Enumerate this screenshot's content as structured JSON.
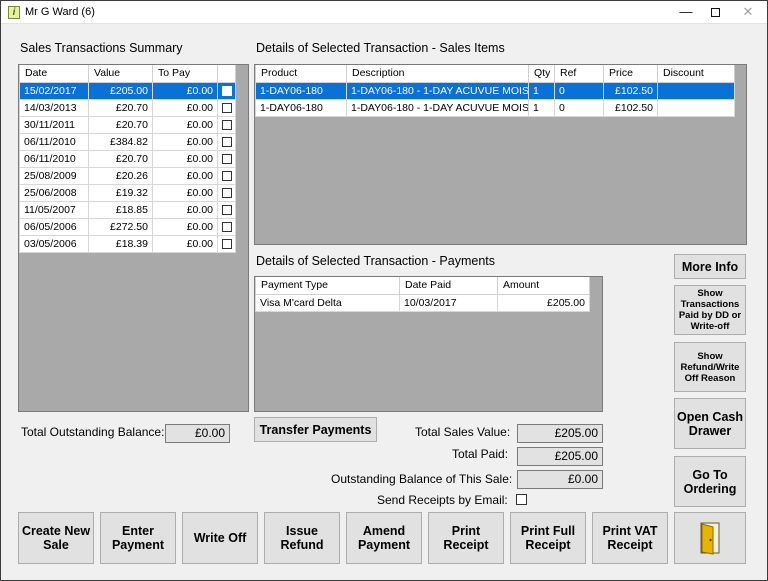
{
  "window": {
    "title": "Mr G Ward (6)",
    "icon": "info-icon",
    "min_glyph": "—",
    "close_glyph": "✕"
  },
  "sales_summary": {
    "title": "Sales Transactions Summary",
    "columns": [
      "Date",
      "Value",
      "To Pay",
      ""
    ],
    "rows": [
      {
        "date": "15/02/2017",
        "value": "£205.00",
        "to_pay": "£0.00",
        "selected": true
      },
      {
        "date": "14/03/2013",
        "value": "£20.70",
        "to_pay": "£0.00"
      },
      {
        "date": "30/11/2011",
        "value": "£20.70",
        "to_pay": "£0.00"
      },
      {
        "date": "06/11/2010",
        "value": "£384.82",
        "to_pay": "£0.00"
      },
      {
        "date": "06/11/2010",
        "value": "£20.70",
        "to_pay": "£0.00"
      },
      {
        "date": "25/08/2009",
        "value": "£20.26",
        "to_pay": "£0.00"
      },
      {
        "date": "25/06/2008",
        "value": "£19.32",
        "to_pay": "£0.00"
      },
      {
        "date": "11/05/2007",
        "value": "£18.85",
        "to_pay": "£0.00"
      },
      {
        "date": "06/05/2006",
        "value": "£272.50",
        "to_pay": "£0.00"
      },
      {
        "date": "03/05/2006",
        "value": "£18.39",
        "to_pay": "£0.00"
      }
    ]
  },
  "sales_items": {
    "title": "Details of Selected Transaction - Sales Items",
    "columns": [
      "Product",
      "Description",
      "Qty",
      "Ref",
      "Price",
      "Discount"
    ],
    "rows": [
      {
        "product": "1-DAY06-180",
        "description": "1-DAY06-180 - 1-DAY ACUVUE MOIS...",
        "qty": "1",
        "ref": "0",
        "price": "£102.50",
        "discount": "",
        "selected": true
      },
      {
        "product": "1-DAY06-180",
        "description": "1-DAY06-180 - 1-DAY ACUVUE MOIS...",
        "qty": "1",
        "ref": "0",
        "price": "£102.50",
        "discount": ""
      }
    ]
  },
  "payments": {
    "title": "Details of Selected Transaction - Payments",
    "columns": [
      "Payment Type",
      "Date Paid",
      "Amount"
    ],
    "rows": [
      {
        "type": "Visa M'card Delta",
        "date_paid": "10/03/2017",
        "amount": "£205.00"
      }
    ]
  },
  "totals": {
    "outstanding_label": "Total Outstanding Balance:",
    "outstanding_value": "£0.00",
    "sales_value_label": "Total Sales Value:",
    "sales_value": "£205.00",
    "paid_label": "Total Paid:",
    "paid_value": "£205.00",
    "sale_balance_label": "Outstanding Balance of This Sale:",
    "sale_balance_value": "£0.00",
    "email_label": "Send Receipts by Email:"
  },
  "buttons": {
    "transfer_payments": "Transfer Payments",
    "more_info": "More Info",
    "show_dd": "Show Transactions Paid by DD or Write-off",
    "show_refund": "Show Refund/Write Off Reason",
    "open_cash_drawer": "Open Cash Drawer",
    "go_to_ordering": "Go To Ordering",
    "create_new_sale": "Create New Sale",
    "enter_payment": "Enter Payment",
    "write_off": "Write Off",
    "issue_refund": "Issue Refund",
    "amend_payment": "Amend Payment",
    "print_receipt": "Print Receipt",
    "print_full_receipt": "Print Full Receipt",
    "print_vat_receipt": "Print VAT Receipt",
    "exit_icon": "exit-door-icon"
  },
  "colors": {
    "selection": "#0a72d6",
    "door": "#e8b400"
  }
}
